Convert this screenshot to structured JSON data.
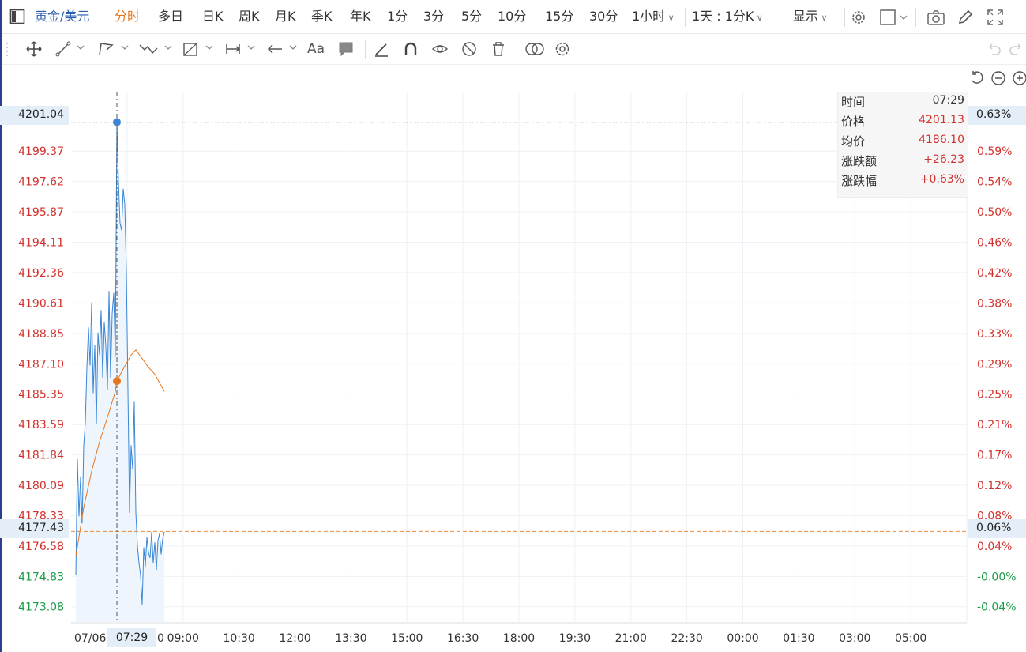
{
  "header": {
    "symbol": "黄金/美元",
    "timeframes": [
      {
        "label": "分时",
        "active": true
      },
      {
        "label": "多日",
        "active": false
      },
      {
        "label": "日K",
        "active": false
      },
      {
        "label": "周K",
        "active": false
      },
      {
        "label": "月K",
        "active": false
      },
      {
        "label": "季K",
        "active": false
      },
      {
        "label": "年K",
        "active": false
      },
      {
        "label": "1分",
        "active": false
      },
      {
        "label": "3分",
        "active": false
      },
      {
        "label": "5分",
        "active": false
      },
      {
        "label": "10分",
        "active": false
      },
      {
        "label": "15分",
        "active": false
      },
      {
        "label": "30分",
        "active": false
      }
    ],
    "interval_dropdown": "1小时",
    "range_dropdown": "1天 : 1分K",
    "display_dropdown": "显示"
  },
  "icons": [
    "sidebar-toggle-icon",
    "settings-gear-icon",
    "layout-square-icon",
    "camera-icon",
    "pencil-icon",
    "fullscreen-icon",
    "move-cross-icon",
    "line-tool-icon",
    "polyline-tool-icon",
    "wave-tool-icon",
    "measure-tool-icon",
    "range-tool-icon",
    "arrow-tool-icon",
    "text-tool-icon",
    "note-tool-icon",
    "brush-icon",
    "magnet-icon",
    "eye-link-icon",
    "hide-drawings-icon",
    "trash-icon",
    "compare-icon",
    "drawing-settings-icon",
    "undo-icon",
    "redo-icon",
    "reset-view-icon",
    "zoom-out-icon",
    "zoom-in-icon"
  ],
  "toolbar": {
    "text_tool_label": "Aa"
  },
  "crosshair": {
    "price_label": "4201.04",
    "percent_label": "0.63%",
    "time_label": "07:29"
  },
  "last_price": {
    "price_label": "4177.43",
    "percent_label": "0.06%"
  },
  "info_panel": [
    {
      "key": "时间",
      "value": "07:29"
    },
    {
      "key": "价格",
      "value": "4201.13"
    },
    {
      "key": "均价",
      "value": "4186.10"
    },
    {
      "key": "涨跌额",
      "value": "+26.23"
    },
    {
      "key": "涨跌幅",
      "value": "+0.63%"
    }
  ],
  "colors": {
    "price_line": "#3a86d4",
    "avg_line": "#e8761f",
    "up": "#d2322d",
    "down": "#1c9b47",
    "area_fill": "#eaf3fc",
    "last_price_line": "#ec8b3c"
  },
  "chart_data": {
    "type": "line",
    "y_axis": {
      "labels": [
        "4199.37",
        "4197.62",
        "4195.87",
        "4194.11",
        "4192.36",
        "4190.61",
        "4188.85",
        "4187.10",
        "4185.35",
        "4183.59",
        "4181.84",
        "4180.09",
        "4178.33",
        "4176.58",
        "4174.83",
        "4173.08"
      ],
      "range": [
        4172.2,
        4202.8
      ]
    },
    "percent_axis": {
      "labels": [
        "0.59%",
        "0.54%",
        "0.50%",
        "0.46%",
        "0.42%",
        "0.38%",
        "0.33%",
        "0.29%",
        "0.25%",
        "0.21%",
        "0.17%",
        "0.12%",
        "0.08%",
        "0.04%",
        "-0.00%",
        "-0.04%"
      ]
    },
    "x_axis": {
      "labels": [
        "07/06",
        "0",
        "09:00",
        "10:30",
        "12:00",
        "13:30",
        "15:00",
        "16:30",
        "18:00",
        "19:30",
        "21:00",
        "22:30",
        "00:00",
        "01:30",
        "03:00",
        "05:00"
      ],
      "range_minutes": [
        0,
        1440
      ]
    },
    "series": [
      {
        "name": "价格",
        "x": [
          0,
          1,
          2,
          3,
          4,
          5,
          6,
          7,
          8,
          9,
          10,
          11,
          12,
          13,
          14,
          15,
          16,
          17,
          18,
          19,
          20,
          21,
          22,
          23,
          24,
          25,
          26,
          27,
          28,
          29,
          30,
          31,
          32,
          33,
          34,
          35,
          36,
          37,
          38,
          39,
          40,
          41,
          42,
          43,
          44,
          45,
          46,
          47,
          48,
          49,
          50,
          51,
          52,
          53,
          54,
          55,
          56
        ],
        "values": [
          4174.9,
          4181.6,
          4178.3,
          4180.6,
          4177.9,
          4182.4,
          4183.7,
          4186.9,
          4189.2,
          4187.0,
          4190.6,
          4185.4,
          4188.2,
          4183.6,
          4188.9,
          4187.6,
          4190.2,
          4186.3,
          4189.5,
          4188.1,
          4185.6,
          4191.3,
          4186.3,
          4190.0,
          4191.2,
          4187.5,
          4201.1,
          4197.6,
          4195.2,
          4194.8,
          4197.2,
          4196.3,
          4192.4,
          4185.6,
          4178.5,
          4182.4,
          4181.0,
          4184.9,
          4178.5,
          4176.6,
          4175.6,
          4174.9,
          4173.2,
          4176.5,
          4175.4,
          4177.1,
          4176.2,
          4175.9,
          4177.4,
          4175.6,
          4176.8,
          4175.2,
          4176.9,
          4177.3,
          4176.1,
          4177.0,
          4177.4
        ]
      },
      {
        "name": "均价",
        "x": [
          0,
          5,
          10,
          15,
          20,
          25,
          26,
          30,
          35,
          38,
          42,
          46,
          50,
          56
        ],
        "values": [
          4176.0,
          4178.8,
          4180.9,
          4182.6,
          4184.0,
          4185.5,
          4186.1,
          4186.8,
          4187.6,
          4187.9,
          4187.4,
          4186.9,
          4186.5,
          4185.5
        ]
      }
    ],
    "last_price": 4177.43,
    "crosshair": {
      "x": 26,
      "price": 4201.04,
      "avg": 4186.1
    }
  }
}
